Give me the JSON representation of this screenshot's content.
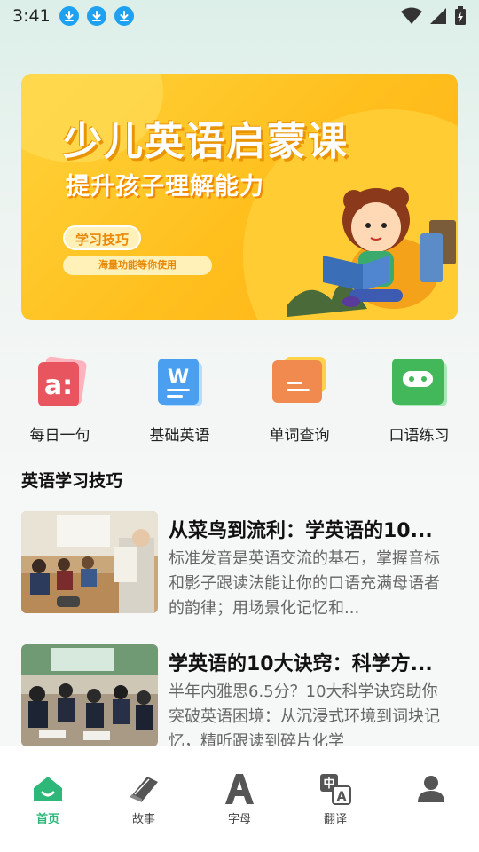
{
  "status": {
    "time": "3:41",
    "download_icons": [
      "download-icon",
      "download-icon",
      "download-icon"
    ],
    "right_icons": [
      "wifi-icon",
      "signal-icon",
      "battery-charging-icon"
    ]
  },
  "banner": {
    "title": "少儿英语启蒙课",
    "subtitle": "提升孩子理解能力",
    "pill_primary": "学习技巧",
    "pill_secondary": "海量功能等你使用"
  },
  "quick_links": [
    {
      "label": "每日一句",
      "icon": "daily-sentence-icon",
      "color": "#e8555f"
    },
    {
      "label": "基础英语",
      "icon": "basic-english-icon",
      "color": "#4a9ff0"
    },
    {
      "label": "单词查询",
      "icon": "word-lookup-icon",
      "color": "#f08a4e"
    },
    {
      "label": "口语练习",
      "icon": "speaking-practice-icon",
      "color": "#42b85a"
    }
  ],
  "section": {
    "title": "英语学习技巧"
  },
  "articles": [
    {
      "title": "从菜鸟到流利：学英语的10...",
      "summary": "标准发音是英语交流的基石，掌握音标和影子跟读法能让你的口语充满母语者的韵律；用场景化记忆和..."
    },
    {
      "title": "学英语的10大诀窍：科学方...",
      "summary": "半年内雅思6.5分？10大科学诀窍助你突破英语困境：从沉浸式环境到词块记忆，精听跟读到碎片化学"
    }
  ],
  "tabs": [
    {
      "label": "首页",
      "icon": "home-icon",
      "active": true
    },
    {
      "label": "故事",
      "icon": "book-icon",
      "active": false
    },
    {
      "label": "字母",
      "icon": "letter-a-icon",
      "active": false
    },
    {
      "label": "翻译",
      "icon": "translate-icon",
      "active": false
    },
    {
      "label": "",
      "icon": "profile-icon",
      "active": false
    }
  ],
  "colors": {
    "accent": "#2db87a",
    "banner": "#ffc21f"
  }
}
